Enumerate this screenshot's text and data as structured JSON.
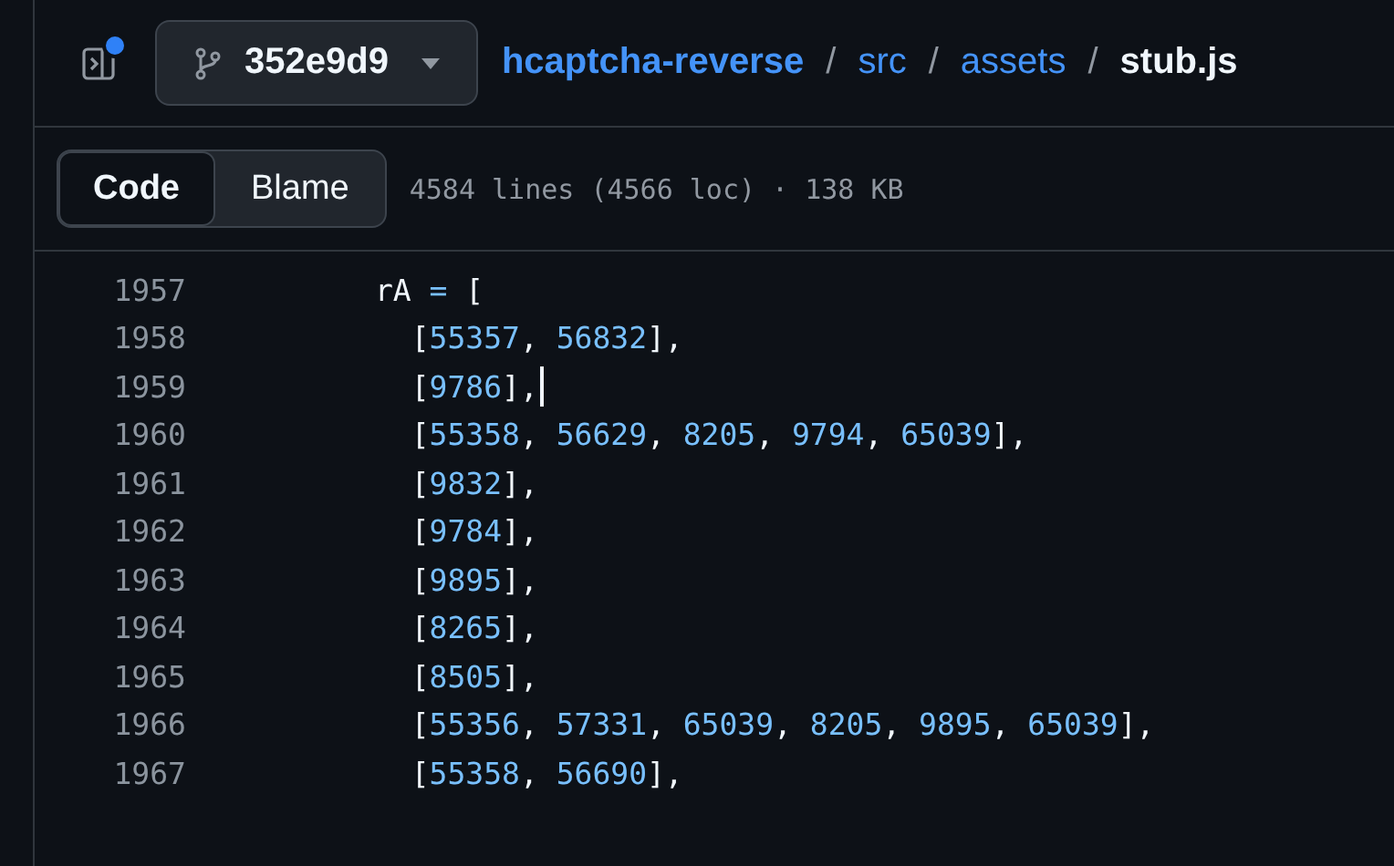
{
  "header": {
    "sidebar_toggle": {
      "notification": true
    },
    "branch": {
      "label": "352e9d9"
    },
    "breadcrumb": [
      {
        "kind": "link",
        "text": "hcaptcha-reverse"
      },
      {
        "kind": "separator",
        "text": "/"
      },
      {
        "kind": "link",
        "text": "src"
      },
      {
        "kind": "separator",
        "text": "/"
      },
      {
        "kind": "link",
        "text": "assets"
      },
      {
        "kind": "separator",
        "text": "/"
      },
      {
        "kind": "current",
        "text": "stub.js"
      }
    ]
  },
  "toolbar": {
    "tabs": [
      {
        "label": "Code",
        "selected": true
      },
      {
        "label": "Blame",
        "selected": false
      }
    ],
    "file_info": "4584 lines (4566 loc) · 138 KB"
  },
  "lines": [
    {
      "number": "1957",
      "caret": false,
      "tokens": [
        {
          "kind": "plain",
          "text": "        rA "
        },
        {
          "kind": "operator",
          "text": "="
        },
        {
          "kind": "plain",
          "text": " ["
        }
      ]
    },
    {
      "number": "1958",
      "caret": false,
      "tokens": [
        {
          "kind": "plain",
          "text": "          ["
        },
        {
          "kind": "number",
          "text": "55357"
        },
        {
          "kind": "plain",
          "text": ", "
        },
        {
          "kind": "number",
          "text": "56832"
        },
        {
          "kind": "plain",
          "text": "],"
        }
      ]
    },
    {
      "number": "1959",
      "caret": true,
      "tokens": [
        {
          "kind": "plain",
          "text": "          ["
        },
        {
          "kind": "number",
          "text": "9786"
        },
        {
          "kind": "plain",
          "text": "],"
        }
      ]
    },
    {
      "number": "1960",
      "caret": false,
      "tokens": [
        {
          "kind": "plain",
          "text": "          ["
        },
        {
          "kind": "number",
          "text": "55358"
        },
        {
          "kind": "plain",
          "text": ", "
        },
        {
          "kind": "number",
          "text": "56629"
        },
        {
          "kind": "plain",
          "text": ", "
        },
        {
          "kind": "number",
          "text": "8205"
        },
        {
          "kind": "plain",
          "text": ", "
        },
        {
          "kind": "number",
          "text": "9794"
        },
        {
          "kind": "plain",
          "text": ", "
        },
        {
          "kind": "number",
          "text": "65039"
        },
        {
          "kind": "plain",
          "text": "],"
        }
      ]
    },
    {
      "number": "1961",
      "caret": false,
      "tokens": [
        {
          "kind": "plain",
          "text": "          ["
        },
        {
          "kind": "number",
          "text": "9832"
        },
        {
          "kind": "plain",
          "text": "],"
        }
      ]
    },
    {
      "number": "1962",
      "caret": false,
      "tokens": [
        {
          "kind": "plain",
          "text": "          ["
        },
        {
          "kind": "number",
          "text": "9784"
        },
        {
          "kind": "plain",
          "text": "],"
        }
      ]
    },
    {
      "number": "1963",
      "caret": false,
      "tokens": [
        {
          "kind": "plain",
          "text": "          ["
        },
        {
          "kind": "number",
          "text": "9895"
        },
        {
          "kind": "plain",
          "text": "],"
        }
      ]
    },
    {
      "number": "1964",
      "caret": false,
      "tokens": [
        {
          "kind": "plain",
          "text": "          ["
        },
        {
          "kind": "number",
          "text": "8265"
        },
        {
          "kind": "plain",
          "text": "],"
        }
      ]
    },
    {
      "number": "1965",
      "caret": false,
      "tokens": [
        {
          "kind": "plain",
          "text": "          ["
        },
        {
          "kind": "number",
          "text": "8505"
        },
        {
          "kind": "plain",
          "text": "],"
        }
      ]
    },
    {
      "number": "1966",
      "caret": false,
      "tokens": [
        {
          "kind": "plain",
          "text": "          ["
        },
        {
          "kind": "number",
          "text": "55356"
        },
        {
          "kind": "plain",
          "text": ", "
        },
        {
          "kind": "number",
          "text": "57331"
        },
        {
          "kind": "plain",
          "text": ", "
        },
        {
          "kind": "number",
          "text": "65039"
        },
        {
          "kind": "plain",
          "text": ", "
        },
        {
          "kind": "number",
          "text": "8205"
        },
        {
          "kind": "plain",
          "text": ", "
        },
        {
          "kind": "number",
          "text": "9895"
        },
        {
          "kind": "plain",
          "text": ", "
        },
        {
          "kind": "number",
          "text": "65039"
        },
        {
          "kind": "plain",
          "text": "],"
        }
      ]
    },
    {
      "number": "1967",
      "caret": false,
      "tokens": [
        {
          "kind": "plain",
          "text": "          ["
        },
        {
          "kind": "number",
          "text": "55358"
        },
        {
          "kind": "plain",
          "text": ", "
        },
        {
          "kind": "number",
          "text": "56690"
        },
        {
          "kind": "plain",
          "text": "],"
        }
      ]
    }
  ]
}
